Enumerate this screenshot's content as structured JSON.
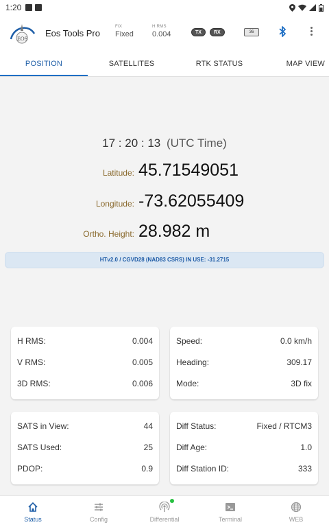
{
  "statusbar": {
    "time": "1:20"
  },
  "appbar": {
    "title": "Eos Tools Pro",
    "fix_label": "FIX",
    "fix_value": "Fixed",
    "hrms_label": "H RMS",
    "hrms_value": "0.004",
    "tx_label": "TX",
    "rx_label": "RX",
    "battery": "36"
  },
  "tabs": [
    "POSITION",
    "SATELLITES",
    "RTK STATUS",
    "MAP VIEW"
  ],
  "position": {
    "time": "17 : 20 : 13",
    "time_suffix": "(UTC Time)",
    "latitude_label": "Latitude:",
    "latitude": "45.71549051",
    "longitude_label": "Longitude:",
    "longitude": "-73.62055409",
    "height_label": "Ortho. Height:",
    "height": "28.982 m",
    "geoid_banner": "HTv2.0 / CGVD28 (NAD83 CSRS) IN USE: -31.2715"
  },
  "cards": {
    "rms": [
      {
        "label": "H RMS:",
        "value": "0.004"
      },
      {
        "label": "V RMS:",
        "value": "0.005"
      },
      {
        "label": "3D RMS:",
        "value": "0.006"
      }
    ],
    "motion": [
      {
        "label": "Speed:",
        "value": "0.0 km/h"
      },
      {
        "label": "Heading:",
        "value": "309.17"
      },
      {
        "label": "Mode:",
        "value": "3D fix"
      }
    ],
    "sats": [
      {
        "label": "SATS in View:",
        "value": "44"
      },
      {
        "label": "SATS Used:",
        "value": "25"
      },
      {
        "label": "PDOP:",
        "value": "0.9"
      }
    ],
    "diff": [
      {
        "label": "Diff Status:",
        "value": "Fixed / RTCM3"
      },
      {
        "label": "Diff Age:",
        "value": "1.0"
      },
      {
        "label": "Diff Station ID:",
        "value": "333"
      }
    ]
  },
  "bottomnav": [
    "Status",
    "Config",
    "Differential",
    "Terminal",
    "WEB"
  ],
  "colors": {
    "accent": "#1f5fa8",
    "label_gold": "#8a6a2e",
    "banner_bg": "#dbe7f3",
    "online_dot": "#27c040"
  }
}
